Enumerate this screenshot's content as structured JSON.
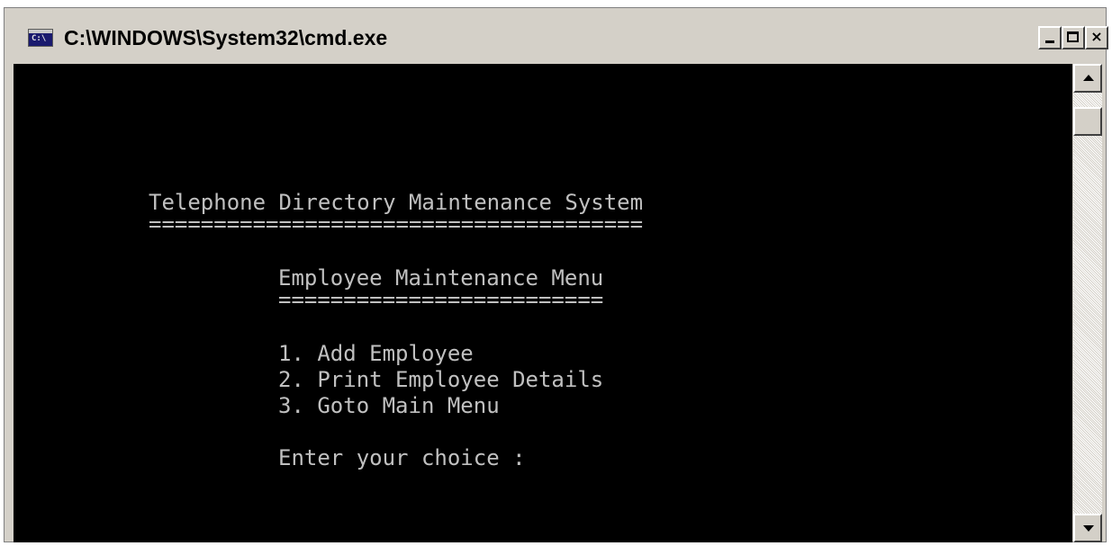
{
  "window": {
    "title": "C:\\WINDOWS\\System32\\cmd.exe",
    "icon": "cmd-icon",
    "icon_text": "C:\\",
    "close_glyph": "×"
  },
  "console": {
    "system_title": "Telephone Directory Maintenance System",
    "system_underline": "======================================",
    "menu_title": "Employee Maintenance Menu",
    "menu_underline": "=========================",
    "options": [
      "1. Add Employee",
      "2. Print Employee Details",
      "3. Goto Main Menu"
    ],
    "prompt": "Enter your choice :"
  },
  "colors": {
    "console_bg": "#000000",
    "console_fg": "#c0c0c0",
    "chrome": "#d4d0c8"
  }
}
